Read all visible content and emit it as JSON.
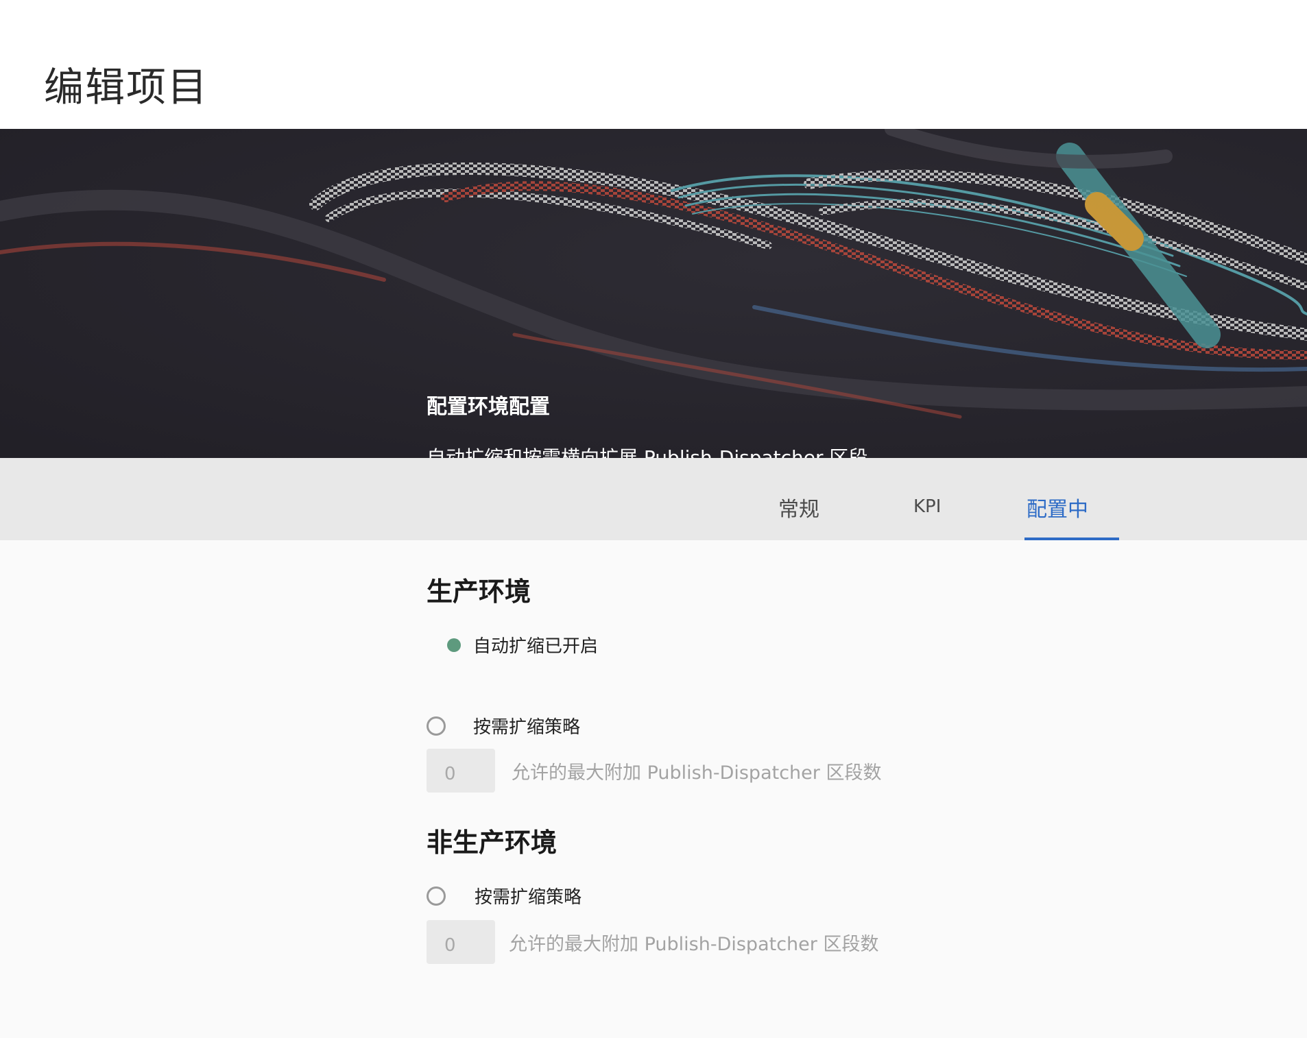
{
  "page": {
    "title": "编辑项目"
  },
  "hero": {
    "title": "配置环境配置",
    "subtitle": "自动扩缩和按需横向扩展 Publish-Dispatcher 区段"
  },
  "tabs": [
    {
      "label": "常规",
      "active": false
    },
    {
      "label": "KPI",
      "active": false
    },
    {
      "label": "配置中",
      "active": true
    }
  ],
  "production": {
    "heading": "生产环境",
    "autoscale_status": "自动扩缩已开启",
    "on_demand_label": "按需扩缩策略",
    "max_segments": {
      "value": "0",
      "hint": "允许的最大附加 Publish-Dispatcher 区段数"
    }
  },
  "non_production": {
    "heading": "非生产环境",
    "on_demand_label": "按需扩缩策略",
    "max_segments": {
      "value": "0",
      "hint": "允许的最大附加 Publish-Dispatcher 区段数"
    }
  },
  "colors": {
    "accent": "#2d6bc6",
    "status_on": "#5e9a7e",
    "hero_bg": "#27252c",
    "tab_bar_bg": "#e8e8e8"
  }
}
